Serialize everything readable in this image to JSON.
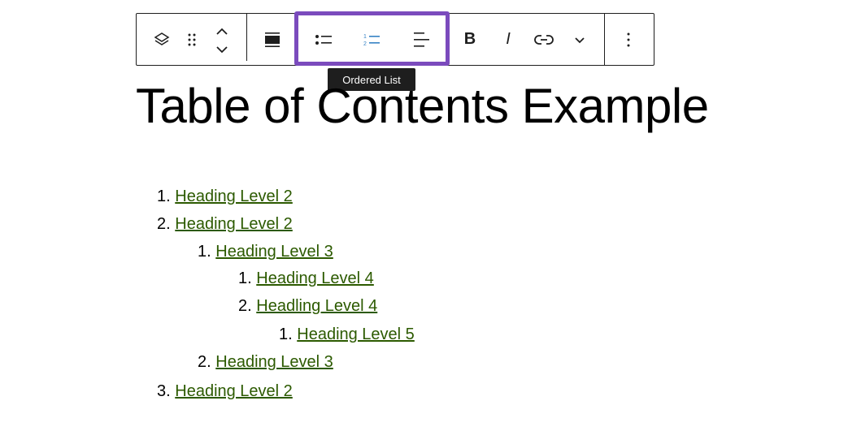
{
  "toolbar": {
    "tooltip": "Ordered List",
    "bold_label": "B",
    "italic_label": "I"
  },
  "title": "Table of Contents Example",
  "list": [
    {
      "num": "1.",
      "text": "Heading Level 2",
      "level": 0
    },
    {
      "num": "2.",
      "text": "Heading Level 2",
      "level": 0
    },
    {
      "num": "1.",
      "text": "Heading Level 3",
      "level": 1
    },
    {
      "num": "1.",
      "text": "Heading Level 4",
      "level": 2
    },
    {
      "num": "2.",
      "text": "Headling Level 4",
      "level": 2
    },
    {
      "num": "1.",
      "text": "Heading Level 5",
      "level": 3
    },
    {
      "num": "2.",
      "text": "Heading Level 3",
      "level": 1
    },
    {
      "num": "3.",
      "text": "Heading Level 2",
      "level": 0
    }
  ],
  "colors": {
    "accent": "#7b4bbd",
    "link": "#2c5a00",
    "active_icon": "#3582c4"
  }
}
